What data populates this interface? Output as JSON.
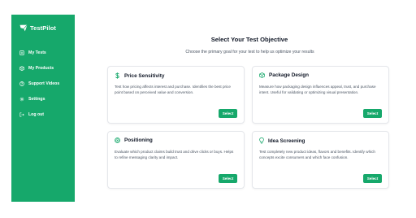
{
  "brand": {
    "name": "TestPilot"
  },
  "sidebar": {
    "items": [
      {
        "label": "My Tests",
        "icon": "tests-icon"
      },
      {
        "label": "My Products",
        "icon": "products-icon"
      },
      {
        "label": "Support Videos",
        "icon": "help-icon"
      },
      {
        "label": "Settings",
        "icon": "gear-icon"
      },
      {
        "label": "Log out",
        "icon": "logout-icon"
      }
    ]
  },
  "main": {
    "title": "Select Your Test Objective",
    "subtitle": "Choose the primary goal for your test to help us optimize your results",
    "cards": [
      {
        "title": "Price Sensitivity",
        "icon": "dollar-icon",
        "description": "Test how pricing affects interest and purchase. Identifies the best price point based on perceived value and conversion.",
        "button": "Select"
      },
      {
        "title": "Package Design",
        "icon": "package-icon",
        "description": "Measure how packaging design influences appeal, trust, and purchase intent. Useful for validating or optimizing visual presentation.",
        "button": "Select"
      },
      {
        "title": "Positioning",
        "icon": "target-icon",
        "description": "Evaluate which product claims build trust and drive clicks or buys. Helps to refine messaging clarity and impact.",
        "button": "Select"
      },
      {
        "title": "Idea Screening",
        "icon": "lightbulb-icon",
        "description": "Test completely new product ideas, flavors and benefits. Identify which concepts excite consumers and which face confusion.",
        "button": "Select"
      }
    ]
  },
  "colors": {
    "accent": "#16a86b"
  }
}
